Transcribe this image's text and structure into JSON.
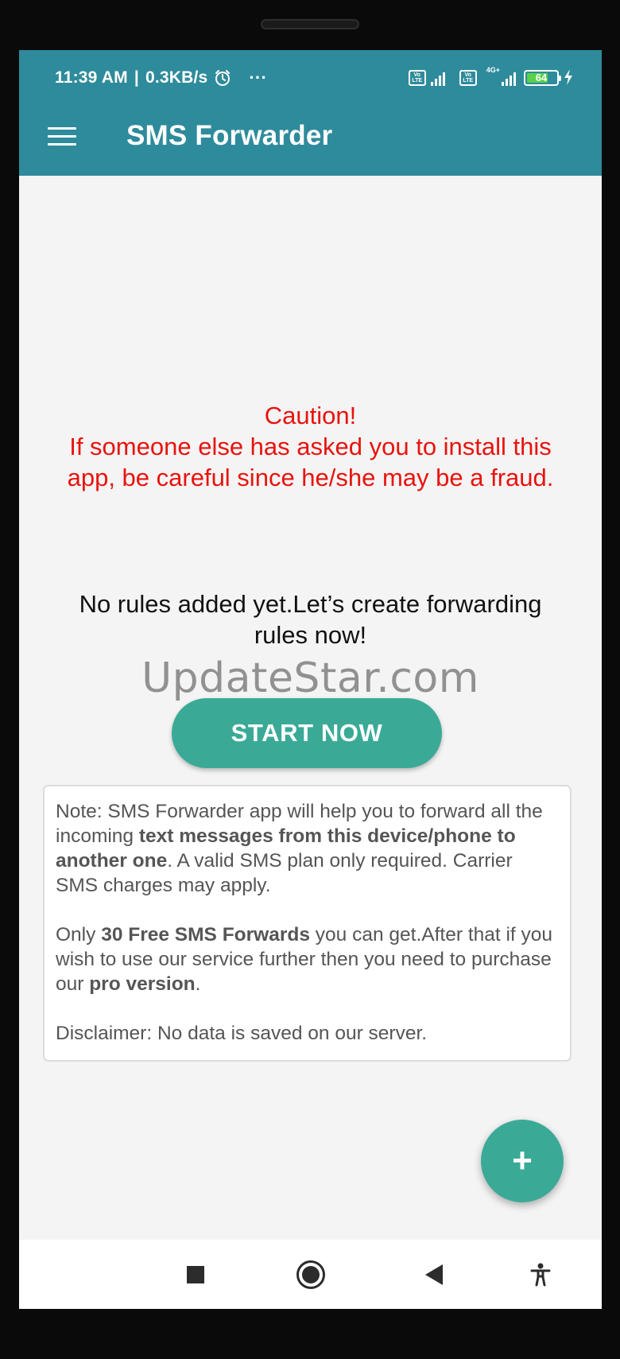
{
  "status_bar": {
    "time": "11:39 AM",
    "separator": "|",
    "speed": "0.3KB/s",
    "more": "···",
    "sim1_label": "Vo LTE",
    "sim2_label": "Vo LTE",
    "network_type": "4G+",
    "battery": "64"
  },
  "toolbar": {
    "title": "SMS Forwarder"
  },
  "caution": {
    "heading": "Caution!",
    "message": "If someone else has asked you to install this app, be careful since he/she may be a fraud."
  },
  "empty_state": {
    "message": "No rules added yet.Let’s create forwarding rules now!"
  },
  "watermark": "UpdateStar.com",
  "start_button": "START NOW",
  "note": {
    "p1_a": "Note: SMS Forwarder app will help you to forward all the incoming ",
    "p1_b": "text messages from this device/phone to another one",
    "p1_c": ". A valid SMS plan only required. Carrier SMS charges may apply.",
    "p2_a": "Only ",
    "p2_b": "30 Free SMS Forwards",
    "p2_c": " you can get.After that if you wish to use our service further then you need to purchase our ",
    "p2_d": "pro version",
    "p2_e": ".",
    "p3": "Disclaimer: No data is saved on our server."
  },
  "fab": "+",
  "colors": {
    "primary": "#2e8b9b",
    "accent": "#3aaa97",
    "caution": "#e8130e",
    "background": "#f4f4f4"
  },
  "icons": {
    "menu": "hamburger-icon",
    "alarm": "alarm-clock-icon",
    "signal": "signal-strength-icon",
    "battery": "battery-icon",
    "charging": "lightning-bolt-icon",
    "recents": "square-icon",
    "home": "circle-icon",
    "back": "triangle-back-icon",
    "accessibility": "accessibility-person-icon"
  }
}
